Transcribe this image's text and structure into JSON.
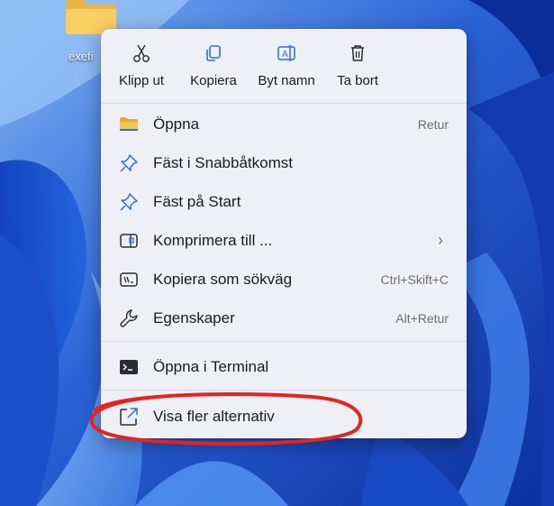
{
  "desktop": {
    "folder_label": "exefi",
    "folder_icon": "folder-icon"
  },
  "menu": {
    "top_actions": [
      {
        "label": "Klipp ut",
        "icon": "scissors-icon"
      },
      {
        "label": "Kopiera",
        "icon": "copy-icon"
      },
      {
        "label": "Byt namn",
        "icon": "rename-icon"
      },
      {
        "label": "Ta bort",
        "icon": "trash-icon"
      }
    ],
    "items": [
      {
        "label": "Öppna",
        "icon": "folder-icon",
        "accelerator": "Retur"
      },
      {
        "label": "Fäst i Snabbåtkomst",
        "icon": "pin-icon",
        "accelerator": ""
      },
      {
        "label": "Fäst på Start",
        "icon": "pin-icon",
        "accelerator": ""
      },
      {
        "label": "Komprimera till ...",
        "icon": "zip-icon",
        "accelerator": "",
        "submenu": true
      },
      {
        "label": "Kopiera som sökväg",
        "icon": "path-icon",
        "accelerator": "Ctrl+Skift+C"
      },
      {
        "label": "Egenskaper",
        "icon": "wrench-icon",
        "accelerator": "Alt+Retur"
      },
      {
        "label": "Öppna i Terminal",
        "icon": "terminal-icon",
        "accelerator": ""
      },
      {
        "label": "Visa fler alternativ",
        "icon": "show-more-icon",
        "accelerator": ""
      }
    ],
    "submenu_glyph": "›"
  },
  "colors": {
    "highlight_ellipse": "#e8231d",
    "menu_background": "#eef0f6",
    "accent_icon": "#2f6fd6"
  }
}
